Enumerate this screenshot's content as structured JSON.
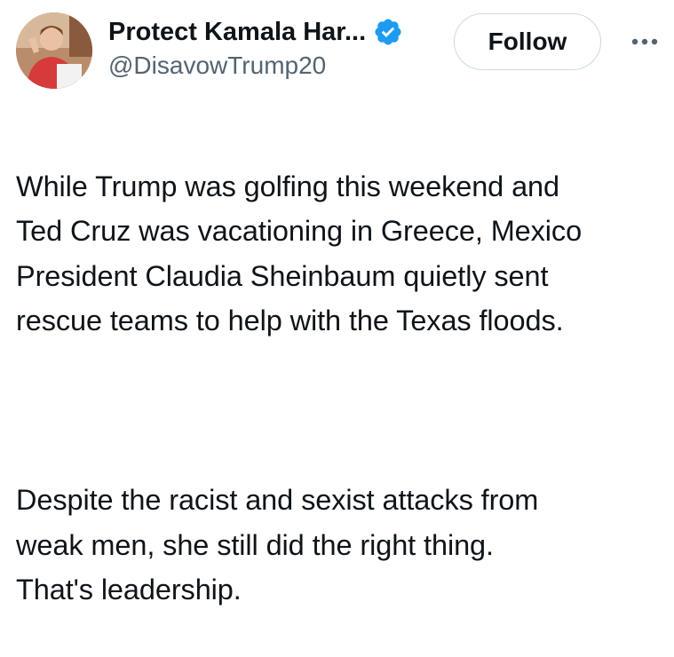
{
  "author": {
    "display_name": "Protect Kamala Har...",
    "handle": "@DisavowTrump20",
    "verified_icon": "verified-badge-icon",
    "avatar_icon": "profile-photo"
  },
  "actions": {
    "follow_label": "Follow",
    "more_icon": "more-options-icon"
  },
  "tweet": {
    "paragraph_1": "While Trump was golfing this weekend and\nTed Cruz was vacationing in Greece, Mexico\nPresident Claudia Sheinbaum quietly sent\nrescue teams to help with the Texas floods.",
    "paragraph_2": "Despite the racist and sexist attacks from\nweak men, she still did the right thing.\nThat's leadership."
  },
  "colors": {
    "text_primary": "#0f1419",
    "text_secondary": "#536471",
    "verified_blue": "#1d9bf0",
    "button_border": "#cfd9de"
  }
}
